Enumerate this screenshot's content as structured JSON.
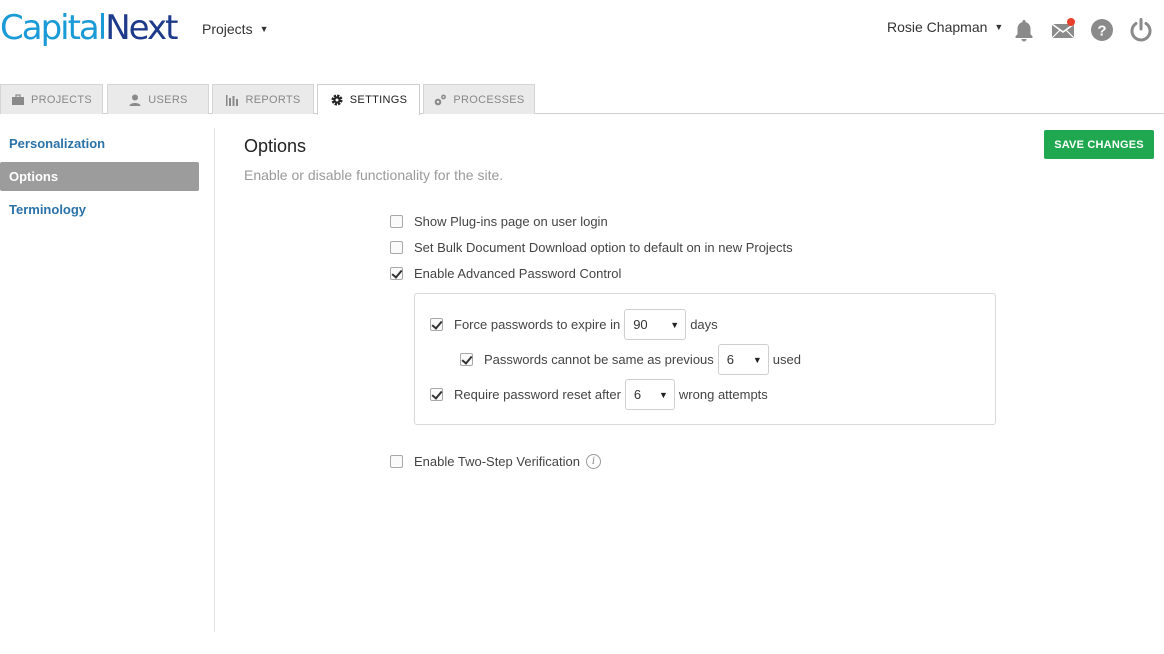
{
  "header": {
    "logo_cap": "Capital",
    "logo_next": "Next",
    "projects_label": "Projects",
    "user_name": "Rosie Chapman",
    "accent": "#1a9ad6",
    "brand_dark": "#1e3a8a",
    "icons": [
      "bell-icon",
      "mail-icon",
      "help-icon",
      "power-icon"
    ]
  },
  "tabs": [
    {
      "label": "PROJECTS",
      "icon": "briefcase-icon"
    },
    {
      "label": "USERS",
      "icon": "user-icon"
    },
    {
      "label": "REPORTS",
      "icon": "bar-chart-icon"
    },
    {
      "label": "SETTINGS",
      "icon": "gear-icon",
      "active": true
    },
    {
      "label": "PROCESSES",
      "icon": "gears-icon"
    }
  ],
  "sidebar": {
    "items": [
      {
        "label": "Personalization"
      },
      {
        "label": "Options",
        "active": true
      },
      {
        "label": "Terminology"
      }
    ]
  },
  "main": {
    "title": "Options",
    "subtitle": "Enable or disable functionality for the site.",
    "save_label": "SAVE CHANGES",
    "save_color": "#1fa850",
    "options": {
      "plugins": {
        "label": "Show Plug-ins page on user login",
        "checked": false
      },
      "bulk": {
        "label": "Set Bulk Document Download option to default on in new Projects",
        "checked": false
      },
      "adv_pwd": {
        "label": "Enable Advanced Password Control",
        "checked": true
      },
      "expire": {
        "label": "Force passwords to expire in",
        "value": "90",
        "suffix": "days",
        "checked": true
      },
      "previous": {
        "label": "Passwords cannot be same as previous",
        "value": "6",
        "suffix": "used",
        "checked": true
      },
      "reset": {
        "label": "Require password reset after",
        "value": "6",
        "suffix": "wrong attempts",
        "checked": true
      },
      "two_step": {
        "label": "Enable Two-Step Verification",
        "checked": false,
        "info": "i"
      }
    }
  }
}
